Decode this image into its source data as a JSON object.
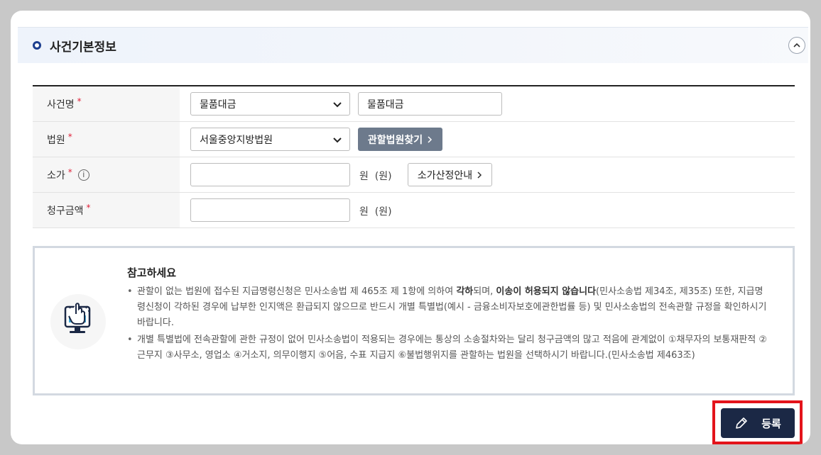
{
  "section": {
    "title": "사건기본정보"
  },
  "form": {
    "case_name": {
      "label": "사건명",
      "required_mark": "*",
      "select_value": "물품대금",
      "input_value": "물품대금"
    },
    "court": {
      "label": "법원",
      "required_mark": "*",
      "select_value": "서울중앙지방법원",
      "find_button": "관할법원찾기"
    },
    "claim_value": {
      "label": "소가",
      "required_mark": "*",
      "input_value": "",
      "unit": "원  (원)",
      "guide_button": "소가산정안내"
    },
    "claim_amount": {
      "label": "청구금액",
      "required_mark": "*",
      "input_value": "",
      "unit": "원  (원)"
    }
  },
  "notice": {
    "title": "참고하세요",
    "item1": {
      "part1": "관할이 없는 법원에 접수된 지급명령신청은 민사소송법 제 465조 제 1항에 의하여 ",
      "bold1": "각하",
      "part2": "되며, ",
      "bold2": "이송이 허용되지 않습니다",
      "part3": "(민사소송법 제34조, 제35조) 또한, 지급명령신청이 각하된 경우에 납부한 인지액은 환급되지 않으므로 반드시 개별 특별법(예시 - 금융소비자보호에관한법률 등) 및 민사소송법의 전속관할 규정을 확인하시기 바랍니다."
    },
    "item2": "개별 특별법에 전속관할에 관한 규정이 없어 민사소송법이 적용되는 경우에는 통상의 소송절차와는 달리 청구금액의 많고 적음에 관계없이 ①채무자의 보통재판적 ②근무지 ③사무소, 영업소 ④거소지, 의무이행지 ⑤어음, 수표 지급지 ⑥불법행위지를 관할하는 법원을 선택하시기 바랍니다.(민사소송법 제463조)"
  },
  "actions": {
    "register": "등록"
  },
  "colors": {
    "accent_navy": "#1b2845",
    "highlight_red": "#e3141b",
    "required_red": "#e0223a"
  }
}
